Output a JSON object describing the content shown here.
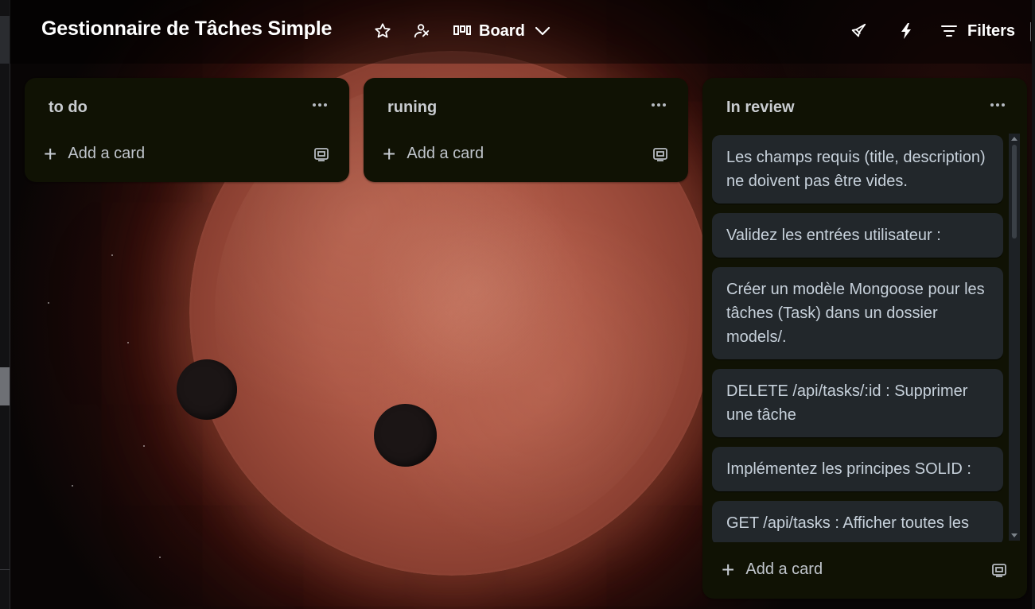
{
  "header": {
    "board_title": "Gestionnaire de Tâches Simple",
    "view_label": "Board",
    "filters_label": "Filters",
    "icons": [
      "star-icon",
      "visibility-icon",
      "board-view-icon",
      "chevron-down-icon",
      "rocket-icon",
      "bolt-icon",
      "filter-icon"
    ]
  },
  "lists": [
    {
      "title": "to do",
      "add_card_label": "Add a card",
      "cards": []
    },
    {
      "title": "runing",
      "add_card_label": "Add a card",
      "cards": []
    },
    {
      "title": "In review",
      "add_card_label": "Add a card",
      "cards": [
        "Les champs requis (title, description) ne doivent pas être vides.",
        "Validez les entrées utilisateur :",
        "Créer un modèle Mongoose pour les tâches (Task) dans un dossier models/.",
        "DELETE /api/tasks/:id : Supprimer une tâche",
        "Implémentez les principes SOLID :",
        "GET /api/tasks : Afficher toutes les"
      ]
    }
  ],
  "colors": {
    "list_bg": "#101204",
    "card_bg": "#22272b",
    "card_text": "#c7d1db",
    "header_text": "#ffffff"
  }
}
